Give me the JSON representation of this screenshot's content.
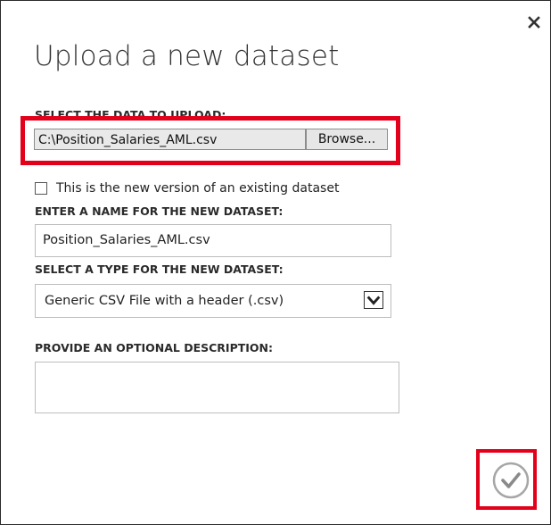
{
  "dialog": {
    "title": "Upload a new dataset"
  },
  "upload": {
    "label": "SELECT THE DATA TO UPLOAD:",
    "file_path": "C:\\Position_Salaries_AML.csv",
    "browse_label": "Browse..."
  },
  "new_version": {
    "label": "This is the new version of an existing dataset",
    "checked": false
  },
  "name": {
    "label": "ENTER A NAME FOR THE NEW DATASET:",
    "value": "Position_Salaries_AML.csv"
  },
  "type": {
    "label": "SELECT A TYPE FOR THE NEW DATASET:",
    "selected": "Generic CSV File with a header (.csv)"
  },
  "description": {
    "label": "PROVIDE AN OPTIONAL DESCRIPTION:",
    "value": ""
  },
  "icons": {
    "close": "close-icon",
    "ok": "checkmark-circle-icon",
    "dropdown": "chevron-down-icon"
  },
  "colors": {
    "highlight": "#e3001b",
    "field_border": "#bdbdbd",
    "file_bg": "#e9e9e9"
  }
}
